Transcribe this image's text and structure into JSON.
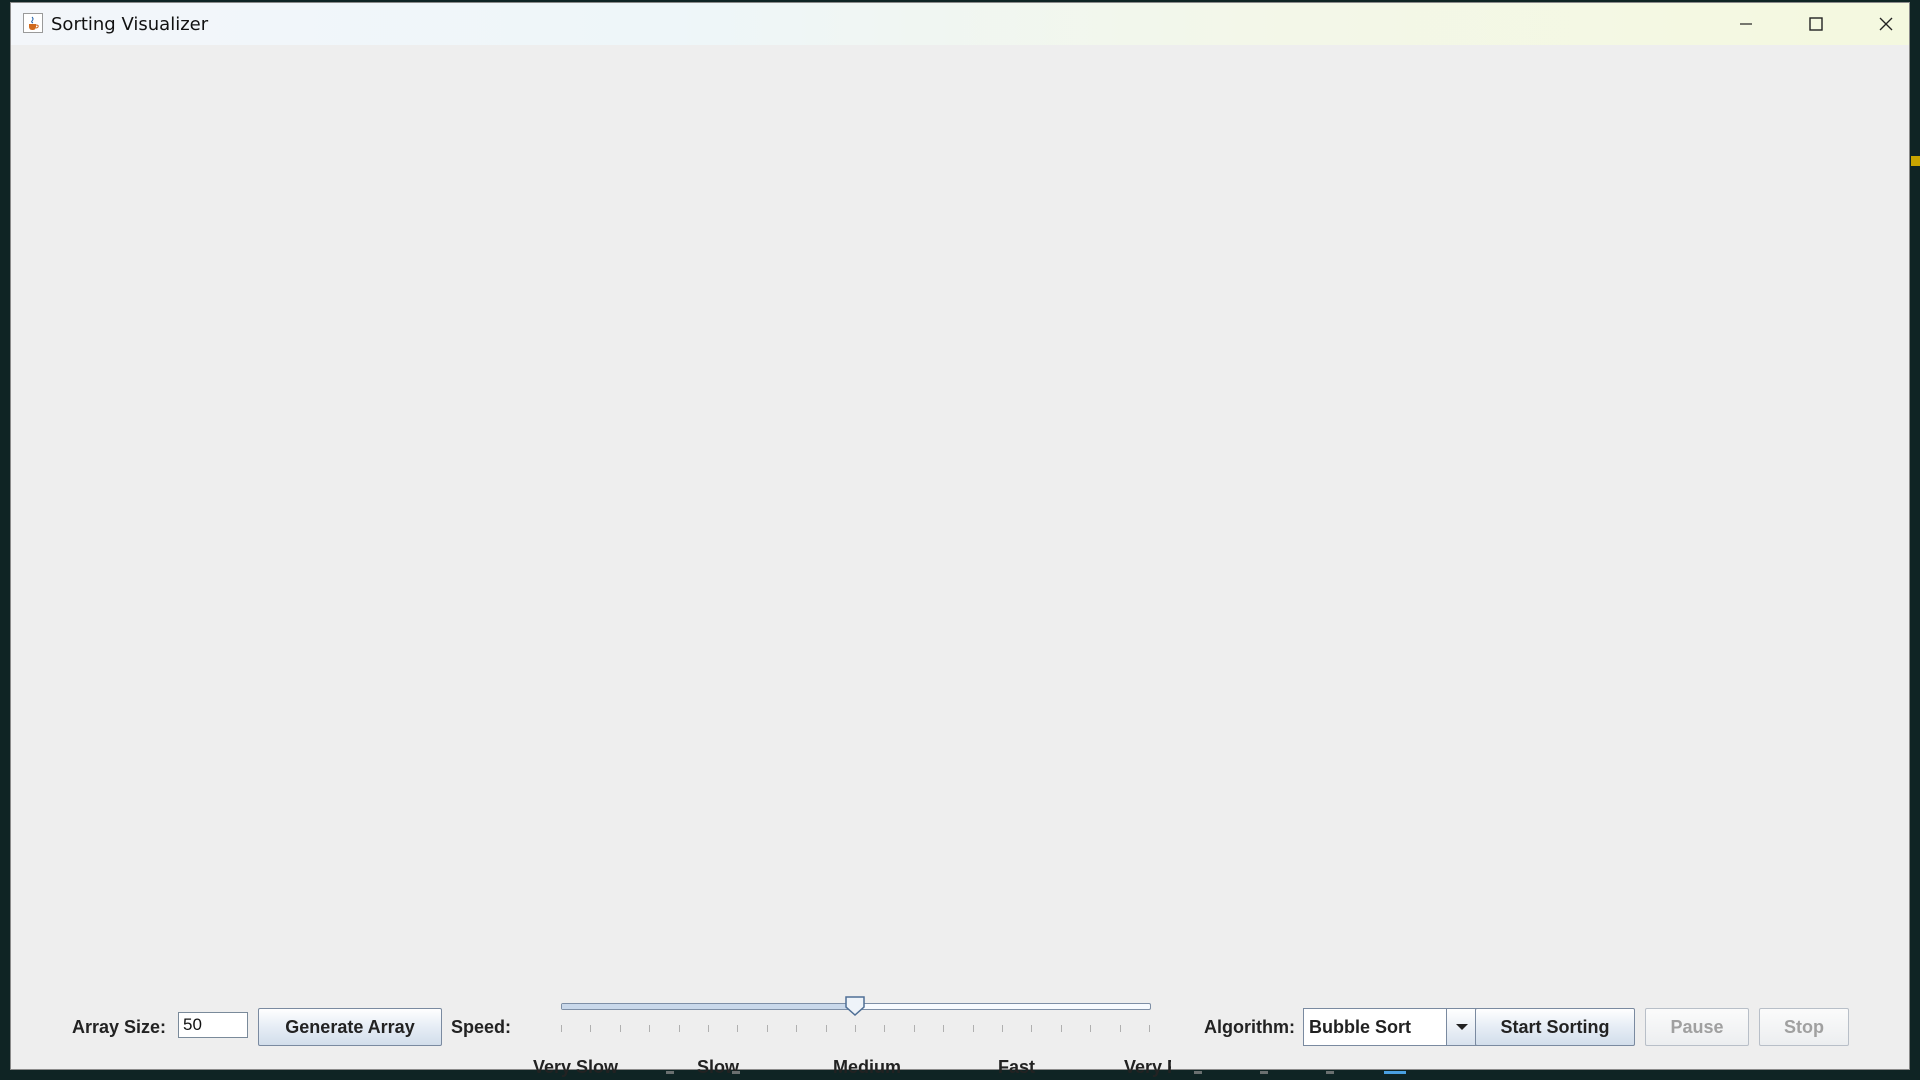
{
  "window": {
    "title": "Sorting Visualizer",
    "icon": "java-cup-icon",
    "controls": {
      "minimize_icon": "minimize-icon",
      "maximize_icon": "maximize-icon",
      "close_icon": "close-icon"
    }
  },
  "controls": {
    "array_size_label": "Array Size:",
    "array_size_value": "50",
    "generate_label": "Generate Array",
    "speed_label": "Speed:",
    "speed_slider": {
      "value_fraction": 0.5,
      "labels": [
        "Very Slow",
        "Slow",
        "Medium",
        "Fast",
        "Very Fast"
      ],
      "minor_ticks": 21
    },
    "algorithm_label": "Algorithm:",
    "algorithm_selected": "Bubble Sort",
    "start_label": "Start Sorting",
    "pause_label": "Pause",
    "stop_label": "Stop",
    "pause_enabled": false,
    "stop_enabled": false
  },
  "colors": {
    "window_bg": "#eeeeee",
    "button_border": "#7a8aa0",
    "disabled_text": "#a0a0a0"
  }
}
